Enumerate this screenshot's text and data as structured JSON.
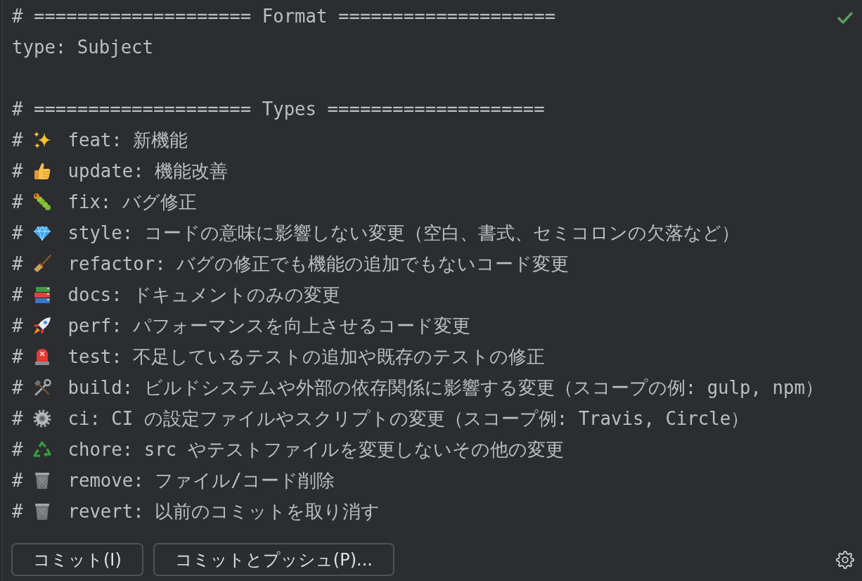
{
  "editor": {
    "format_heading": "# ==================== Format ====================",
    "format_template": "type: Subject",
    "types_heading": "# ==================== Types ====================",
    "types": [
      {
        "prefix": "#",
        "kind": "sparkles",
        "text": "feat: 新機能"
      },
      {
        "prefix": "#",
        "kind": "thumbsup",
        "text": "update: 機能改善"
      },
      {
        "prefix": "#",
        "kind": "caterpillar",
        "text": "fix: バグ修正"
      },
      {
        "prefix": "#",
        "kind": "gem",
        "text": "style: コードの意味に影響しない変更（空白、書式、セミコロンの欠落など）"
      },
      {
        "prefix": "#",
        "kind": "broom",
        "text": "refactor: バグの修正でも機能の追加でもないコード変更"
      },
      {
        "prefix": "#",
        "kind": "books",
        "text": "docs: ドキュメントのみの変更"
      },
      {
        "prefix": "#",
        "kind": "rocket",
        "text": "perf: パフォーマンスを向上させるコード変更"
      },
      {
        "prefix": "#",
        "kind": "siren",
        "text": "test: 不足しているテストの追加や既存のテストの修正"
      },
      {
        "prefix": "#",
        "kind": "tools",
        "text": "build: ビルドシステムや外部の依存関係に影響する変更（スコープの例: gulp, npm）"
      },
      {
        "prefix": "#",
        "kind": "gear",
        "text": "ci: CI の設定ファイルやスクリプトの変更（スコープ例: Travis, Circle）"
      },
      {
        "prefix": "#",
        "kind": "recycle",
        "text": "chore: src やテストファイルを変更しないその他の変更"
      },
      {
        "prefix": "#",
        "kind": "wastebasket",
        "text": "remove: ファイル/コード削除"
      },
      {
        "prefix": "#",
        "kind": "wastebasket",
        "text": "revert: 以前のコミットを取り消す"
      }
    ]
  },
  "buttons": [
    {
      "label": "コミット(I)"
    },
    {
      "label": "コミットとプッシュ(P)..."
    }
  ]
}
